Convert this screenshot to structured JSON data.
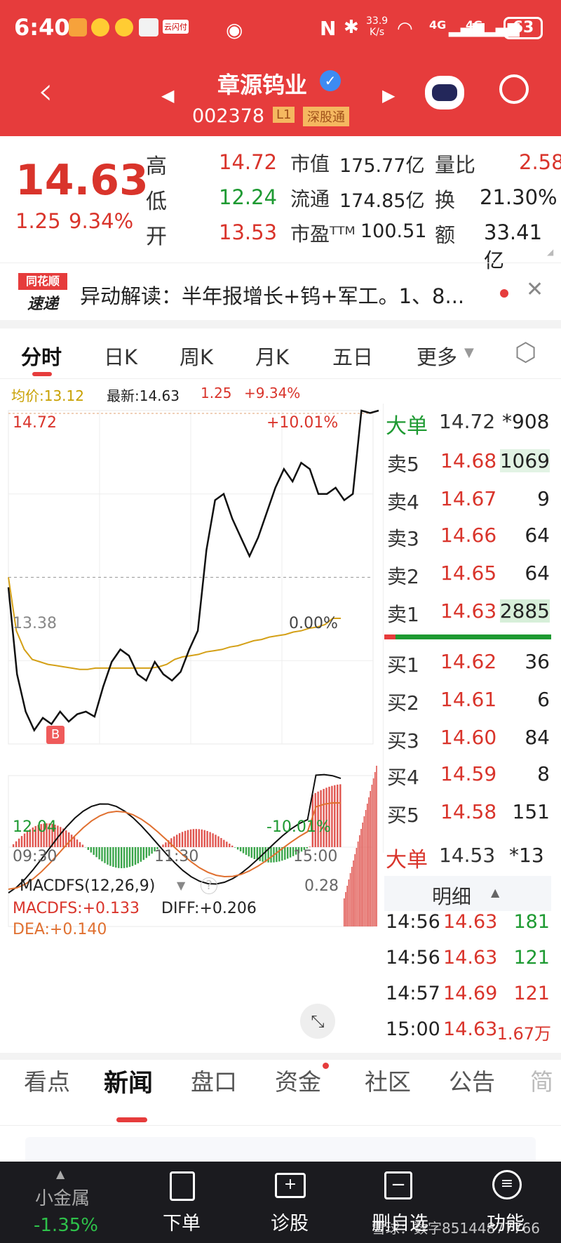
{
  "status": {
    "time": "6:40",
    "net_speed_top": "33.9",
    "net_speed_unit": "K/s",
    "signal1": "4G",
    "signal2": "4G",
    "battery": "63",
    "app_badge": "云闪付"
  },
  "stock": {
    "name": "章源钨业",
    "code": "002378",
    "tag_l1": "L1",
    "tag_connect": "深股通"
  },
  "quote": {
    "price": "14.63",
    "change": "1.25",
    "change_pct": "9.34%",
    "high_label": "高",
    "high": "14.72",
    "low_label": "低",
    "low": "12.24",
    "open_label": "开",
    "open": "13.53",
    "mcap_label": "市值",
    "mcap": "175.77亿",
    "float_label": "流通",
    "float": "174.85亿",
    "pe_label": "市盈ᵀᵀᴹ",
    "pe": "100.51",
    "vr_label": "量比",
    "vr": "2.58",
    "turnover_label": "换",
    "turnover": "21.30%",
    "amount_label": "额",
    "amount": "33.41亿"
  },
  "news_banner": {
    "logo_top": "同花顺",
    "logo_bottom": "速递",
    "text": "异动解读：半年报增长+钨+军工。1、8..."
  },
  "chart_tabs": [
    "分时",
    "日K",
    "周K",
    "月K",
    "五日",
    "更多"
  ],
  "chart_info": {
    "avg": "均价:13.12",
    "latest": "最新:14.63",
    "chg": "1.25",
    "chg_pct": "+9.34%"
  },
  "chart_data": {
    "type": "line",
    "title": "",
    "xlabel": "",
    "ylabel": "",
    "ylim": [
      12.04,
      14.72
    ],
    "ref_price": 13.38,
    "y_labels": {
      "top": "14.72",
      "mid": "13.38",
      "bottom": "12.04",
      "top_pct": "+10.01%",
      "mid_pct": "0.00%",
      "bottom_pct": "-10.01%"
    },
    "x_labels": [
      "09:30",
      "11:30",
      "15:00"
    ],
    "series": [
      {
        "values": [
          13.3,
          12.6,
          12.3,
          12.15,
          12.25,
          12.2,
          12.3,
          12.22,
          12.28,
          12.3,
          12.26,
          12.5,
          12.7,
          12.8,
          12.75,
          12.6,
          12.55,
          12.7,
          12.6,
          12.55,
          12.62,
          12.8,
          12.95,
          13.6,
          14.0,
          14.05,
          13.85,
          13.7,
          13.55,
          13.7,
          13.9,
          14.1,
          14.25,
          14.15,
          14.3,
          14.25,
          14.05,
          14.05,
          14.1,
          14.0,
          14.05,
          14.72,
          14.7,
          14.72
        ]
      },
      {
        "values": [
          13.38,
          12.95,
          12.8,
          12.72,
          12.7,
          12.68,
          12.67,
          12.66,
          12.65,
          12.64,
          12.64,
          12.65,
          12.65,
          12.65,
          12.65,
          12.65,
          12.65,
          12.65,
          12.65,
          12.66,
          12.68,
          12.72,
          12.74,
          12.75,
          12.76,
          12.78,
          12.79,
          12.8,
          12.82,
          12.83,
          12.85,
          12.87,
          12.88,
          12.9,
          12.91,
          12.92,
          12.94,
          12.95,
          12.97,
          12.98,
          13.0,
          13.05,
          13.05
        ]
      }
    ],
    "marker": "B"
  },
  "macd": {
    "title": "MACDFS(12,26,9)",
    "macd": "MACDFS:+0.133",
    "diff": "DIFF:+0.206",
    "dea": "DEA:+0.140",
    "max": "0.28"
  },
  "orderbook": {
    "big_label": "大单",
    "big_price": "14.72",
    "big_vol": "*908",
    "asks": [
      {
        "label": "卖5",
        "price": "14.68",
        "vol": "1069"
      },
      {
        "label": "卖4",
        "price": "14.67",
        "vol": "9"
      },
      {
        "label": "卖3",
        "price": "14.66",
        "vol": "64"
      },
      {
        "label": "卖2",
        "price": "14.65",
        "vol": "64"
      },
      {
        "label": "卖1",
        "price": "14.63",
        "vol": "2885"
      }
    ],
    "bids": [
      {
        "label": "买1",
        "price": "14.62",
        "vol": "36"
      },
      {
        "label": "买2",
        "price": "14.61",
        "vol": "6"
      },
      {
        "label": "买3",
        "price": "14.60",
        "vol": "84"
      },
      {
        "label": "买4",
        "price": "14.59",
        "vol": "8"
      },
      {
        "label": "买5",
        "price": "14.58",
        "vol": "151"
      }
    ],
    "big2_label": "大单",
    "big2_price": "14.53",
    "big2_vol": "*13"
  },
  "ticks": {
    "title": "明细",
    "rows": [
      {
        "t": "14:56",
        "p": "14.63",
        "v": "181"
      },
      {
        "t": "14:56",
        "p": "14.63",
        "v": "121"
      },
      {
        "t": "14:57",
        "p": "14.69",
        "v": "121"
      },
      {
        "t": "15:00",
        "p": "14.63",
        "v": "1.67万"
      }
    ]
  },
  "bottom_tabs": [
    "看点",
    "新闻",
    "盘口",
    "资金",
    "社区",
    "公告",
    "简"
  ],
  "bottom_bar": {
    "sector": "小金属",
    "sector_chg": "-1.35%",
    "order": "下单",
    "diagnose": "诊股",
    "watchlist": "删自选",
    "functions": "功能",
    "watermark": "雪球：数字85144877766"
  },
  "colors": {
    "brand": "#e63c3c",
    "up": "#d9342b",
    "down": "#1e9a32",
    "avg_line": "#d4a017"
  }
}
